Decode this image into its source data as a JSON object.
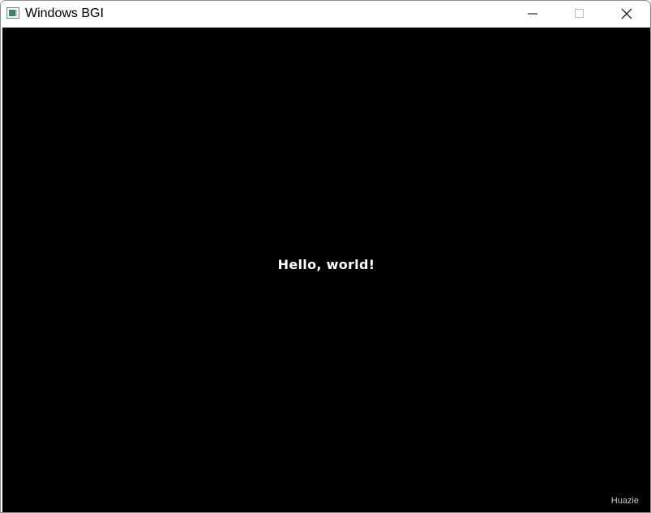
{
  "window": {
    "title": "Windows BGI",
    "app_icon": "bgi-window-icon",
    "controls": {
      "minimize_icon": "minimize-icon",
      "maximize_icon": "maximize-icon",
      "close_icon": "close-icon"
    }
  },
  "canvas": {
    "background": "#000000",
    "text": "Hello, world!",
    "text_color": "#ffffff"
  },
  "watermark": {
    "text": "Huazie"
  }
}
